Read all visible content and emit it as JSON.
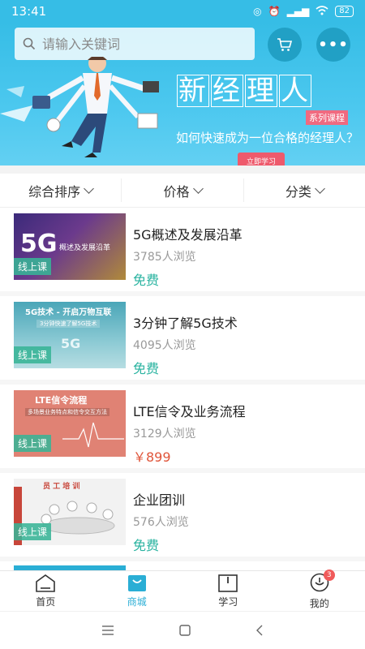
{
  "status": {
    "time": "13:41",
    "battery": "82"
  },
  "search": {
    "placeholder": "请输入关键词"
  },
  "banner": {
    "headline_chars": [
      "新",
      "经",
      "理",
      "人"
    ],
    "tag": "系列课程",
    "subtitle": "如何快速成为一位合格的经理人？",
    "cta": "立即学习",
    "pages": 5,
    "active_page": 0
  },
  "sort": {
    "comprehensive": "综合排序",
    "price": "价格",
    "category": "分类"
  },
  "courses": [
    {
      "title": "5G概述及发展沿革",
      "views": "3785人浏览",
      "price": "免费",
      "tag": "线上课",
      "thumb_text": "概述及发展沿革",
      "thumb_big": "5G"
    },
    {
      "title": "3分钟了解5G技术",
      "views": "4095人浏览",
      "price": "免费",
      "tag": "线上课",
      "thumb_text": "5G技术 - 开启万物互联",
      "thumb_sub": "3分钟快速了解5G技术",
      "thumb_big": "5G"
    },
    {
      "title": "LTE信令及业务流程",
      "views": "3129人浏览",
      "price": "￥899",
      "tag": "线上课",
      "thumb_text": "LTE信令流程",
      "thumb_sub": "多场景业务特点和信令交互方法"
    },
    {
      "title": "企业团训",
      "views": "576人浏览",
      "price": "免费",
      "tag": "线上课",
      "thumb_text": "员 工 培 训"
    }
  ],
  "tabs": [
    {
      "label": "首页"
    },
    {
      "label": "商城"
    },
    {
      "label": "学习"
    },
    {
      "label": "我的",
      "badge": "3"
    }
  ],
  "colors": {
    "primary": "#36bde6",
    "accent_green": "#29b3a0",
    "price_red": "#e0553a",
    "cta_pink": "#ee5a6c"
  }
}
